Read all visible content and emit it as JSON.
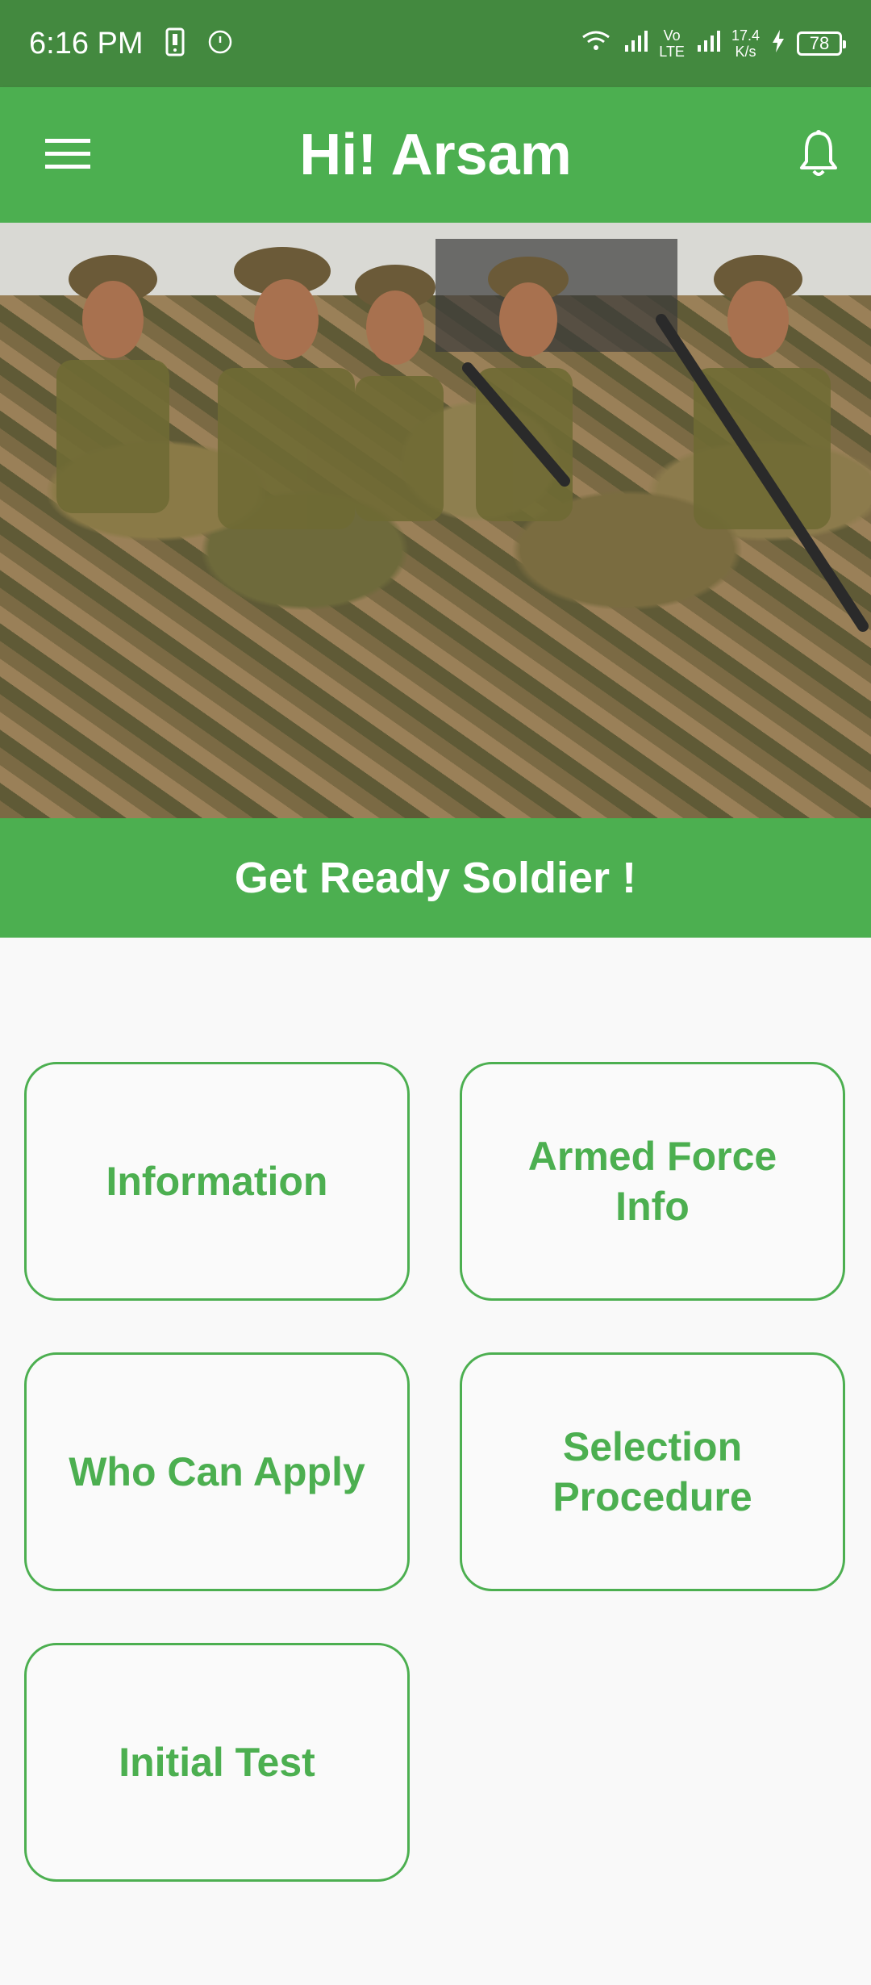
{
  "status_bar": {
    "time": "6:16 PM",
    "network_speed": "17.4",
    "network_unit": "K/s",
    "volte_top": "Vo",
    "volte_bottom": "LTE",
    "battery": "78"
  },
  "app_bar": {
    "title": "Hi! Arsam",
    "menu_icon": "hamburger-menu-icon",
    "notification_icon": "bell-icon"
  },
  "banner": {
    "text": "Get Ready Soldier !"
  },
  "cards": [
    {
      "label": "Information"
    },
    {
      "label": "Armed Force Info"
    },
    {
      "label": "Who Can Apply"
    },
    {
      "label": "Selection Procedure"
    },
    {
      "label": "Initial Test"
    }
  ],
  "colors": {
    "status_bar": "#43893f",
    "primary": "#4caf50",
    "background": "#f9f9f9"
  }
}
